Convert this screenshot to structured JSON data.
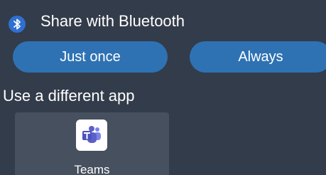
{
  "header": {
    "icon": "bluetooth-icon",
    "title": "Share with Bluetooth"
  },
  "actions": {
    "just_once_label": "Just once",
    "always_label": "Always"
  },
  "section": {
    "label": "Use a different app"
  },
  "apps": [
    {
      "label": "Teams",
      "icon": "teams-icon"
    }
  ],
  "colors": {
    "background": "#333c4a",
    "button": "#2e72b3",
    "tile": "#46505e",
    "bluetooth": "#2f6fd0",
    "teams": "#5b5fc7"
  }
}
